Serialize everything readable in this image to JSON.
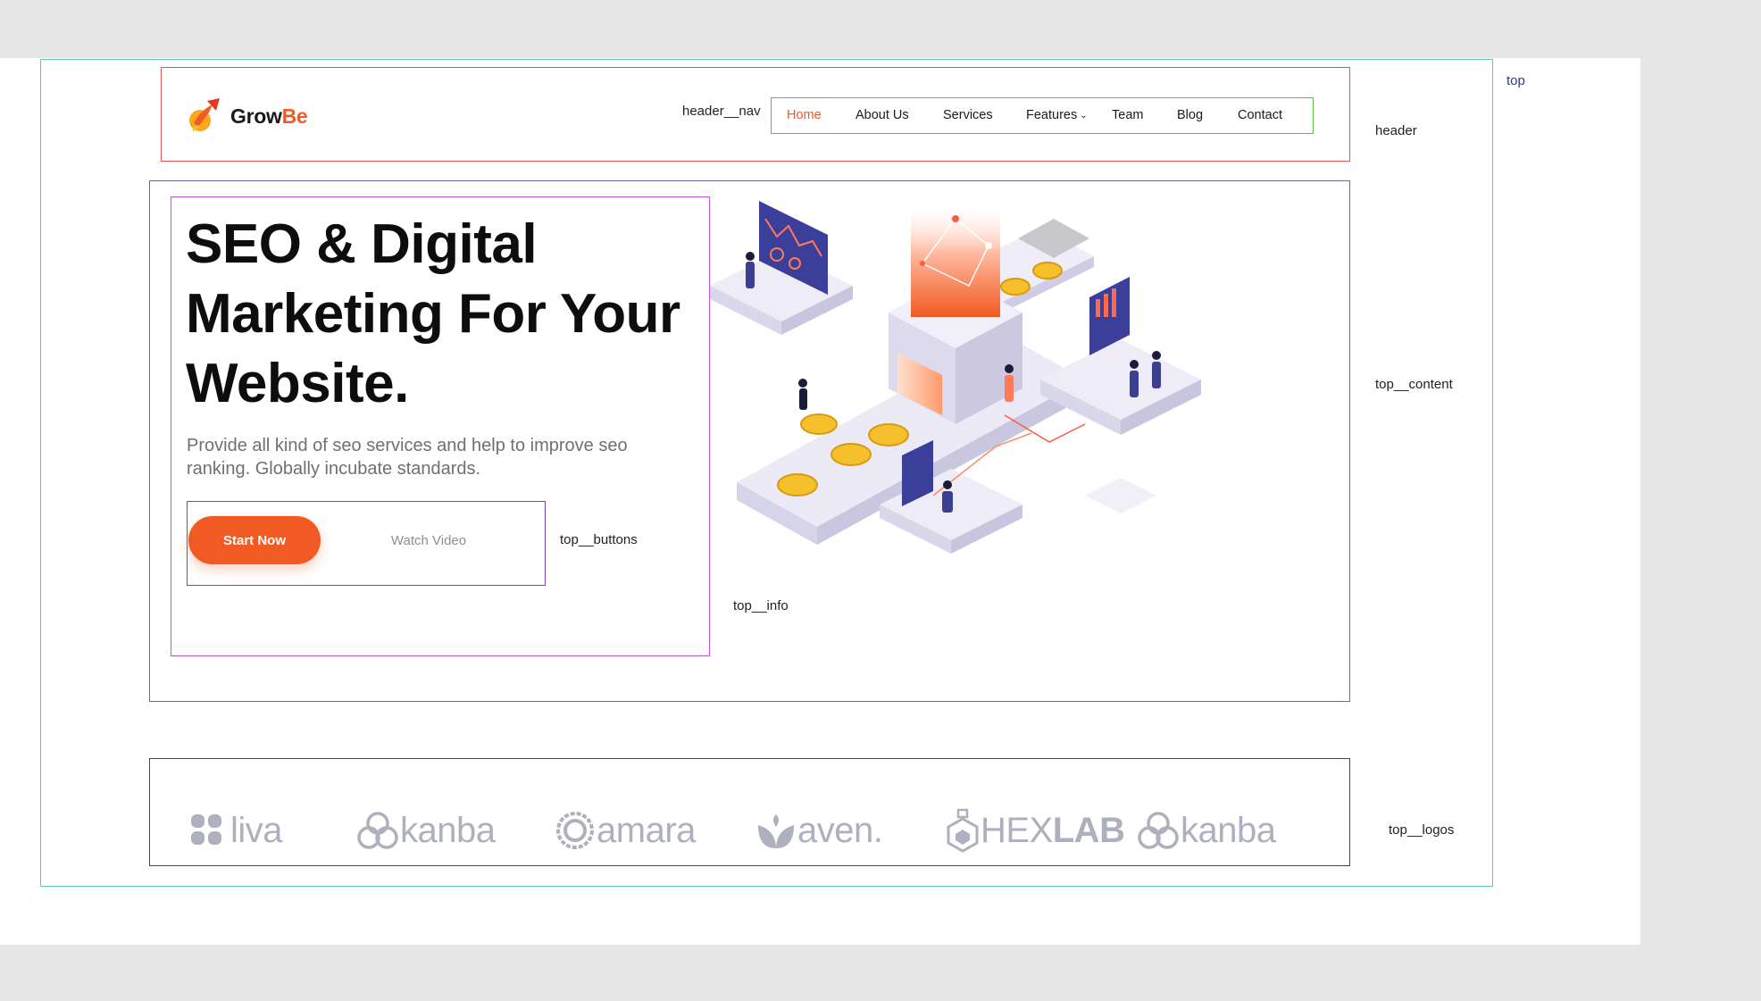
{
  "annotations": {
    "top": "top",
    "header": "header",
    "header_nav": "header__nav",
    "top_content": "top__content",
    "top_info": "top__info",
    "top_buttons": "top__buttons",
    "top_logos": "top__logos"
  },
  "brand": {
    "name_part1": "Grow",
    "name_part2": "Be",
    "accent_color": "#f15a22"
  },
  "nav": {
    "items": [
      {
        "label": "Home",
        "active": true
      },
      {
        "label": "About Us"
      },
      {
        "label": "Services"
      },
      {
        "label": "Features",
        "has_dropdown": true
      },
      {
        "label": "Team"
      },
      {
        "label": "Blog"
      },
      {
        "label": "Contact"
      }
    ]
  },
  "hero": {
    "title_line1": "SEO & Digital",
    "title_line2": "Marketing For Your",
    "title_line3": "Website.",
    "description": "Provide all kind of seo services and help to improve seo ranking. Globally incubate standards.",
    "start_button": "Start Now",
    "watch_button": "Watch Video",
    "illustration_icon": "isometric-seo-illustration"
  },
  "logos": [
    {
      "text": "liva",
      "icon": "liva-logo-icon"
    },
    {
      "text": "kanba",
      "icon": "kanba-logo-icon"
    },
    {
      "text": "amara",
      "icon": "amara-logo-icon"
    },
    {
      "text": "aven.",
      "icon": "aven-logo-icon"
    },
    {
      "text_light": "HEX",
      "text_bold": "LAB",
      "icon": "hexlab-logo-icon"
    },
    {
      "text": "kanba",
      "icon": "kanba-logo-icon"
    }
  ]
}
